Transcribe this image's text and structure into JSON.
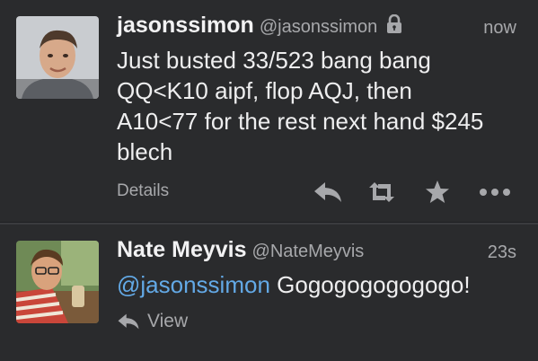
{
  "tweets": [
    {
      "display_name": "jasonssimon",
      "screen_name": "@jasonssimon",
      "protected_icon": "lock-icon",
      "time": "now",
      "text_lines": [
        "Just busted 33/523 bang bang",
        "QQ<K10 aipf, flop AQJ, then",
        "A10<77 for the rest next hand $245",
        "blech"
      ],
      "details_label": "Details",
      "actions": [
        "reply-icon",
        "retweet-icon",
        "favorite-icon",
        "more-icon"
      ]
    },
    {
      "display_name": "Nate Meyvis",
      "screen_name": "@NateMeyvis",
      "time": "23s",
      "mention": "@jasonssimon",
      "text_rest": " Gogogogogogogo!",
      "view_label": "View",
      "view_icon": "reply-icon"
    }
  ],
  "colors": {
    "background": "#2a2b2d",
    "text": "#eeeeef",
    "muted": "#a7a8ab",
    "mention": "#63a9e6"
  }
}
